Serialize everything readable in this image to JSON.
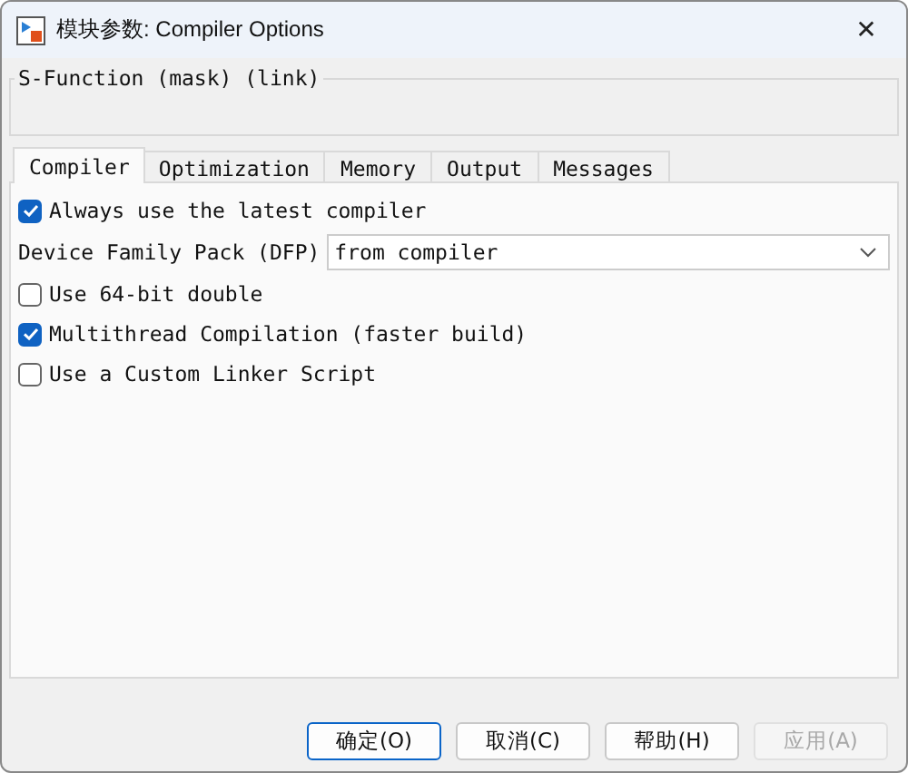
{
  "window": {
    "title": "模块参数: Compiler Options",
    "close": "✕"
  },
  "group": {
    "title": "S-Function (mask) (link)"
  },
  "tabs": [
    {
      "label": "Compiler",
      "selected": true
    },
    {
      "label": "Optimization",
      "selected": false
    },
    {
      "label": "Memory",
      "selected": false
    },
    {
      "label": "Output",
      "selected": false
    },
    {
      "label": "Messages",
      "selected": false
    }
  ],
  "rows": [
    {
      "kind": "checkbox",
      "label": "Always use the latest compiler",
      "checked": true
    },
    {
      "kind": "dropdown",
      "label": "Device Family Pack (DFP)",
      "value": "from compiler"
    },
    {
      "kind": "checkbox",
      "label": "Use 64-bit double",
      "checked": false
    },
    {
      "kind": "checkbox",
      "label": "Multithread Compilation (faster build)",
      "checked": true
    },
    {
      "kind": "checkbox",
      "label": "Use a Custom Linker Script",
      "checked": false
    }
  ],
  "buttons": [
    {
      "label": "确定(O)",
      "disabled": false,
      "default": true
    },
    {
      "label": "取消(C)",
      "disabled": false,
      "default": false
    },
    {
      "label": "帮助(H)",
      "disabled": false,
      "default": false
    },
    {
      "label": "应用(A)",
      "disabled": true,
      "default": false
    }
  ]
}
